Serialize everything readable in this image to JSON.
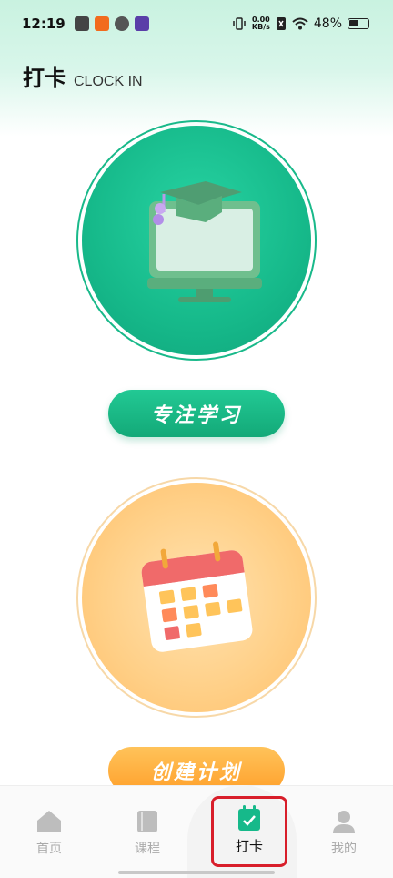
{
  "status_bar": {
    "time": "12:19",
    "speed_top": "0.00",
    "speed_bottom": "KB/s",
    "battery": "48%"
  },
  "header": {
    "title": "打卡",
    "subtitle": "CLOCK IN"
  },
  "cards": {
    "focus": {
      "button_label": "专注学习",
      "icon": "graduation-computer-icon"
    },
    "plan": {
      "button_label": "创建计划",
      "icon": "calendar-icon"
    }
  },
  "nav": {
    "items": [
      {
        "label": "首页",
        "icon": "home-icon"
      },
      {
        "label": "课程",
        "icon": "book-icon"
      },
      {
        "label": "打卡",
        "icon": "calendar-check-icon"
      },
      {
        "label": "我的",
        "icon": "user-icon"
      }
    ],
    "active_index": 2
  },
  "colors": {
    "accent_green": "#16b98a",
    "accent_orange": "#ffab3c",
    "highlight_red": "#d81e2a"
  }
}
